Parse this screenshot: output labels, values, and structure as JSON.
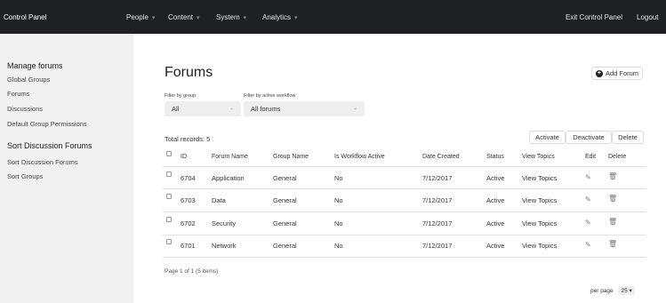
{
  "topbar": {
    "brand": "Control Panel",
    "nav": [
      "People",
      "Content",
      "System",
      "Analytics"
    ],
    "exit": "Exit Control Panel",
    "logout": "Logout"
  },
  "sidebar": {
    "section1": "Manage forums",
    "items1": [
      "Global Groups",
      "Forums",
      "Discussions",
      "Default Group Permissions"
    ],
    "section2": "Sort Discussion Forums",
    "items2": [
      "Sort Discussion Forums",
      "Sort Groups"
    ]
  },
  "main": {
    "title": "Forums",
    "add_button": "Add Forum",
    "filter_group_label": "Filter by group",
    "filter_group_value": "All",
    "filter_workflow_label": "Filter by active workflow",
    "filter_workflow_value": "All forums",
    "total": "Total records: 5",
    "bulk_actions": [
      "Activate",
      "Deactivate",
      "Delete"
    ]
  },
  "table": {
    "headers": [
      "ID",
      "Forum Name",
      "Group Name",
      "Is Workflow Active",
      "Date Created",
      "Status",
      "View Topics",
      "Edit",
      "Delete"
    ],
    "rows": [
      {
        "id": "6704",
        "name": "Application",
        "group": "General",
        "workflow": "No",
        "date": "7/12/2017",
        "status": "Active",
        "view": "View Topics"
      },
      {
        "id": "6703",
        "name": "Data",
        "group": "General",
        "workflow": "No",
        "date": "7/12/2017",
        "status": "Active",
        "view": "View Topics"
      },
      {
        "id": "6702",
        "name": "Security",
        "group": "General",
        "workflow": "No",
        "date": "7/12/2017",
        "status": "Active",
        "view": "View Topics"
      },
      {
        "id": "6701",
        "name": "Network",
        "group": "General",
        "workflow": "No",
        "date": "7/12/2017",
        "status": "Active",
        "view": "View Topics"
      }
    ]
  },
  "footer": {
    "page_info": "Page 1 of 1 (5 items)",
    "per_page_label": "per page",
    "per_page_value": "25"
  },
  "icons": {
    "caret": "chevron-down-icon",
    "add": "plus-circle-icon",
    "edit": "edit-icon",
    "delete": "trash-icon"
  }
}
